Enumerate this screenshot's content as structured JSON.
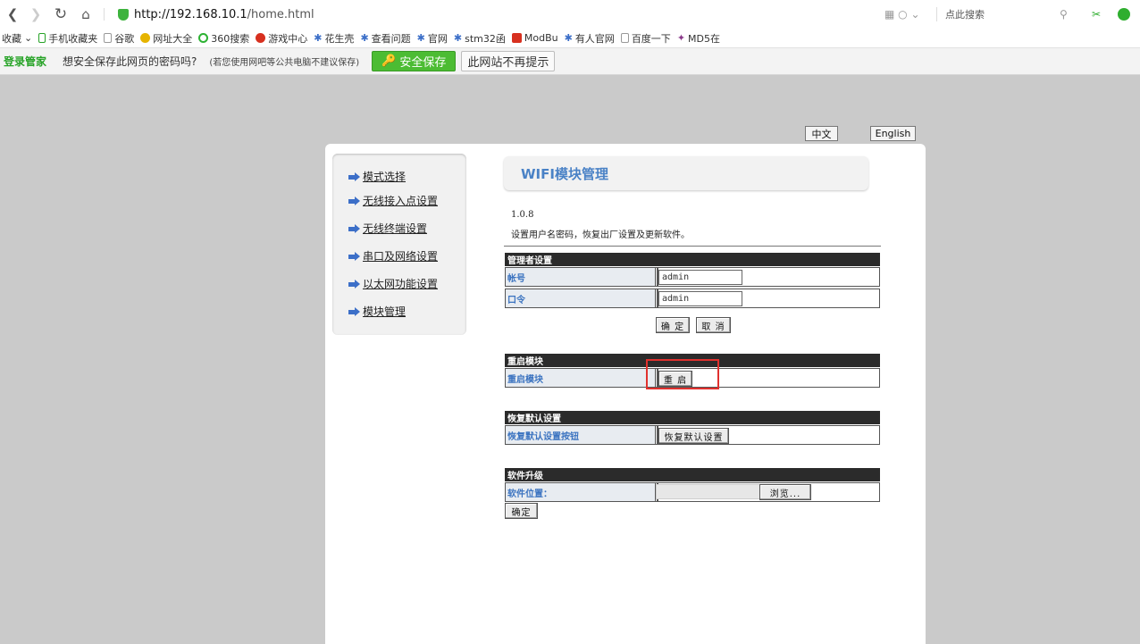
{
  "browser": {
    "url_host": "http://192.168.10.1",
    "url_path": "/home.html",
    "search_placeholder": "点此搜索"
  },
  "bookmarks": [
    {
      "label": "收藏",
      "icon": "chevron-down-icon",
      "color": "#ffffff"
    },
    {
      "label": "手机收藏夹",
      "icon": "phone-icon",
      "color": "#27a327"
    },
    {
      "label": "谷歌",
      "icon": "page-icon",
      "color": "#dddddd"
    },
    {
      "label": "网址大全",
      "icon": "globe-icon",
      "color": "#e6b400"
    },
    {
      "label": "360搜索",
      "icon": "search-ring-icon",
      "color": "#2db233"
    },
    {
      "label": "游戏中心",
      "icon": "game-icon",
      "color": "#d7301f"
    },
    {
      "label": "花生壳",
      "icon": "person-icon",
      "color": "#3c6fc8"
    },
    {
      "label": "查看问题",
      "icon": "person-icon",
      "color": "#3c6fc8"
    },
    {
      "label": "官网",
      "icon": "person-icon",
      "color": "#3c6fc8"
    },
    {
      "label": "stm32函",
      "icon": "person-icon",
      "color": "#3c6fc8"
    },
    {
      "label": "ModBu",
      "icon": "c-logo-icon",
      "color": "#d7301f"
    },
    {
      "label": "有人官网",
      "icon": "person-icon",
      "color": "#3c6fc8"
    },
    {
      "label": "百度一下",
      "icon": "page-icon",
      "color": "#dddddd"
    },
    {
      "label": "MD5在",
      "icon": "md5-icon",
      "color": "#8b3a8b"
    }
  ],
  "password_bar": {
    "brand": "登录管家",
    "question": "想安全保存此网页的密码吗?",
    "note": "(若您使用网吧等公共电脑不建议保存)",
    "save_button": "安全保存",
    "never_button": "此网站不再提示"
  },
  "lang": {
    "zh": "中文",
    "en": "English"
  },
  "menu": [
    "模式选择",
    "无线接入点设置",
    "无线终端设置",
    "串口及网络设置",
    "以太网功能设置",
    "模块管理"
  ],
  "header": {
    "title": "WIFI模块管理",
    "version": "1.0.8",
    "description": "设置用户名密码，恢复出厂设置及更新软件。"
  },
  "admin": {
    "section_title": "管理者设置",
    "account_label": "帐号",
    "account_value": "admin",
    "password_label": "口令",
    "password_value": "admin",
    "ok_button": "确 定",
    "cancel_button": "取 消"
  },
  "restart": {
    "section_title": "重启模块",
    "label": "重启模块",
    "button": "重 启"
  },
  "factory": {
    "section_title": "恢复默认设置",
    "label": "恢复默认设置按钮",
    "button": "恢复默认设置"
  },
  "upgrade": {
    "section_title": "软件升级",
    "label": "软件位置：",
    "browse_button": "浏览...",
    "ok_button": "确定"
  },
  "colors": {
    "accent_title": "#4a82c6",
    "label_blue": "#3b73c0",
    "save_green": "#4cbc33",
    "highlight_red": "#e0312e"
  }
}
